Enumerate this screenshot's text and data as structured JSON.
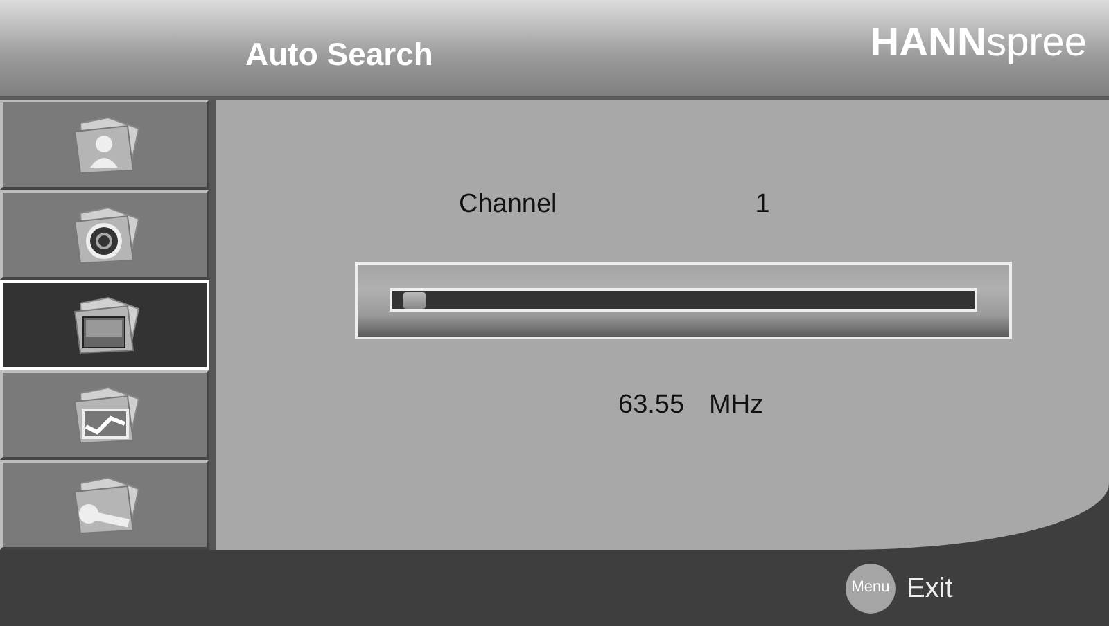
{
  "header": {
    "title": "Auto Search",
    "logo": "**HANN**spree"
  },
  "sidebar": {
    "items": [
      {
        "kind": "person",
        "selected": false
      },
      {
        "kind": "disc",
        "selected": false
      },
      {
        "kind": "screen",
        "selected": true
      },
      {
        "kind": "picture",
        "selected": false
      },
      {
        "kind": "wrench",
        "selected": false
      }
    ]
  },
  "channel": {
    "label": "Channel",
    "value": "1"
  },
  "progress": {
    "level": 0.02
  },
  "frequency": {
    "value": "63.55",
    "unit": "MHz"
  },
  "footer": {
    "key": "Menu",
    "action": "Exit"
  }
}
